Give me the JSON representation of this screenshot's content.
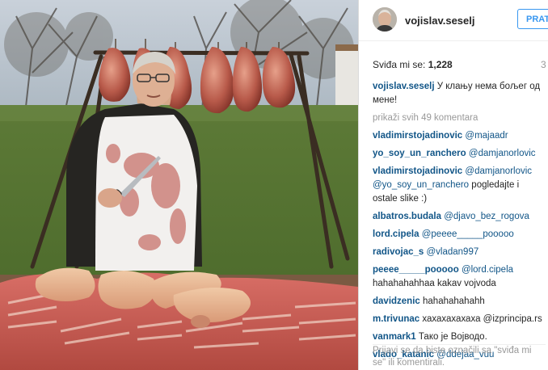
{
  "profile": {
    "username": "vojislav.seselj",
    "follow_label": "PRATI"
  },
  "post": {
    "likes_label": "Sviđa mi se:",
    "likes_count": "1,228",
    "age": "3",
    "caption_user": "vojislav.seselj",
    "caption_text": "У клању нема бољег од мене!",
    "more_comments": "prikaži svih 49 komentara"
  },
  "comments": [
    {
      "user": "vladimirstojadinovic",
      "mention": "@majaadr",
      "text": ""
    },
    {
      "user": "yo_soy_un_ranchero",
      "mention": "@damjanorlovic",
      "text": ""
    },
    {
      "user": "vladimirstojadinovic",
      "mention": "@damjanorlovic @yo_soy_un_ranchero",
      "text": "pogledajte i ostale slike :)"
    },
    {
      "user": "albatros.budala",
      "mention": "@djavo_bez_rogova",
      "text": ""
    },
    {
      "user": "lord.cipela",
      "mention": "@peeee_____pooooo",
      "text": ""
    },
    {
      "user": "radivojac_s",
      "mention": "@vladan997",
      "text": ""
    },
    {
      "user": "peeee_____pooooo",
      "mention": "@lord.cipela",
      "text": "hahahahahhaa kakav vojvoda"
    },
    {
      "user": "davidzenic",
      "mention": "",
      "text": "hahahahahahh"
    },
    {
      "user": "m.trivunac",
      "mention": "",
      "text": "хахахахахаха @izprincipa.rs"
    },
    {
      "user": "vanmark1",
      "mention": "",
      "text": "Тако је Војводо."
    },
    {
      "user": "vlado_katanic",
      "mention": "@ddejaa_vuu",
      "text": ""
    }
  ],
  "footer": {
    "login_text": "Prijavi se da biste označili sa \"sviđa mi se\" ili komentirali."
  },
  "colors": {
    "link": "#125688",
    "button": "#3897f0",
    "muted": "#999999"
  }
}
